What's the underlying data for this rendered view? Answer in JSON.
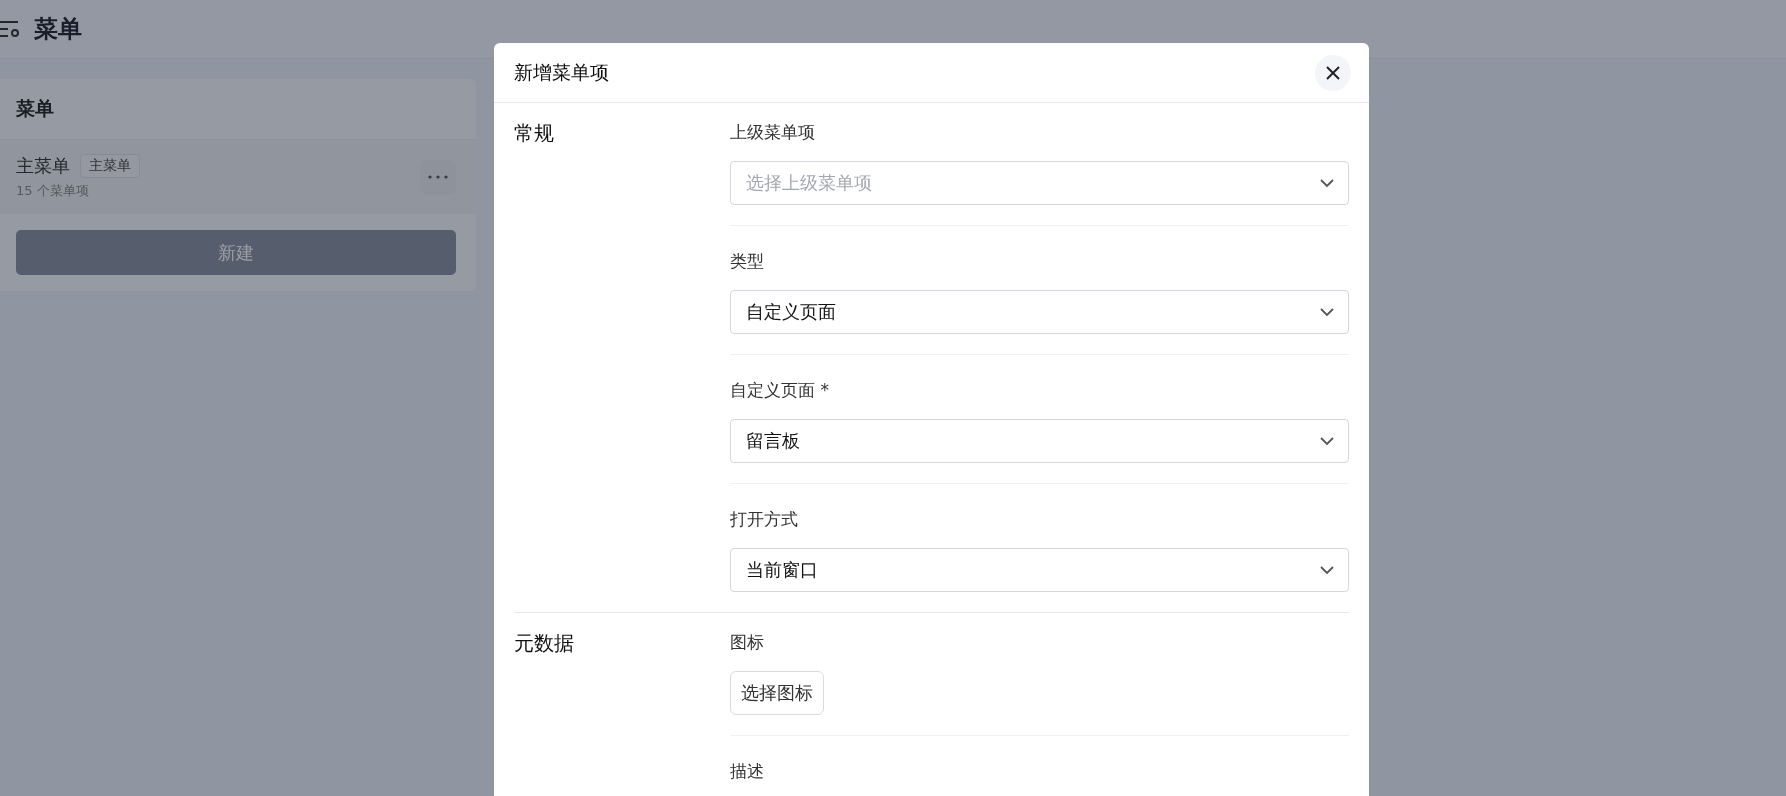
{
  "page": {
    "title": "菜单"
  },
  "menus_panel": {
    "title": "菜单",
    "items": [
      {
        "name": "主菜单",
        "tag": "主菜单",
        "count": "15 个菜单项"
      }
    ],
    "new_button": "新建"
  },
  "dialog": {
    "title": "新增菜单项",
    "sections": [
      {
        "title": "常规",
        "fields": [
          {
            "kind": "select",
            "label": "上级菜单项",
            "placeholder": "选择上级菜单项"
          },
          {
            "kind": "select",
            "label": "类型",
            "value": "自定义页面"
          },
          {
            "kind": "select",
            "label": "自定义页面 *",
            "value": "留言板"
          },
          {
            "kind": "select",
            "label": "打开方式",
            "value": "当前窗口"
          }
        ]
      },
      {
        "title": "元数据",
        "fields": [
          {
            "kind": "button",
            "label": "图标",
            "button": "选择图标"
          },
          {
            "kind": "text",
            "label": "描述"
          }
        ]
      }
    ]
  }
}
